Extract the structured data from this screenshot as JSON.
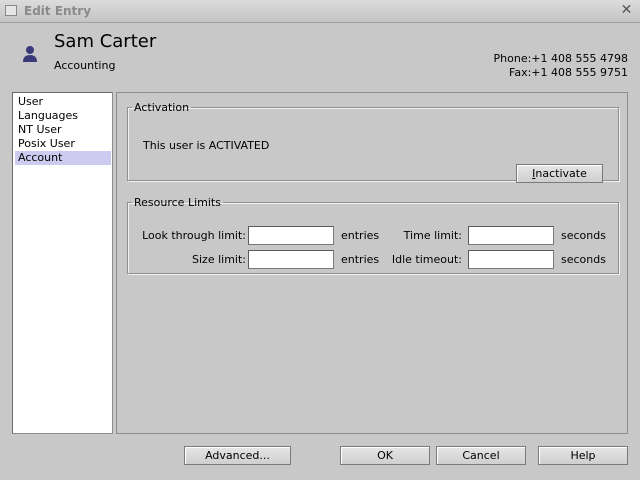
{
  "window": {
    "title": "Edit Entry"
  },
  "user": {
    "name": "Sam Carter",
    "department": "Accounting",
    "phone": "Phone:+1 408 555 4798",
    "fax": "Fax:+1 408 555 9751"
  },
  "nav": {
    "items": [
      {
        "label": "User"
      },
      {
        "label": "Languages"
      },
      {
        "label": "NT User"
      },
      {
        "label": "Posix User"
      },
      {
        "label": "Account"
      }
    ],
    "selected": "Account"
  },
  "activation": {
    "legend": "Activation",
    "status": "This user is ACTIVATED",
    "button_mnemonic": "I",
    "button_rest": "nactivate"
  },
  "resource_limits": {
    "legend": "Resource Limits",
    "look_through_label": "Look through limit:",
    "look_through_value": "",
    "look_through_unit": "entries",
    "size_label": "Size limit:",
    "size_value": "",
    "size_unit": "entries",
    "time_label": "Time limit:",
    "time_value": "",
    "time_unit": "seconds",
    "idle_label": "Idle timeout:",
    "idle_value": "",
    "idle_unit": "seconds"
  },
  "buttons": {
    "advanced": "Advanced...",
    "ok": "OK",
    "cancel": "Cancel",
    "help": "Help"
  },
  "colors": {
    "background": "#c8c8c8",
    "selection": "#cdccf0",
    "user_icon": "#3a3a7a"
  }
}
